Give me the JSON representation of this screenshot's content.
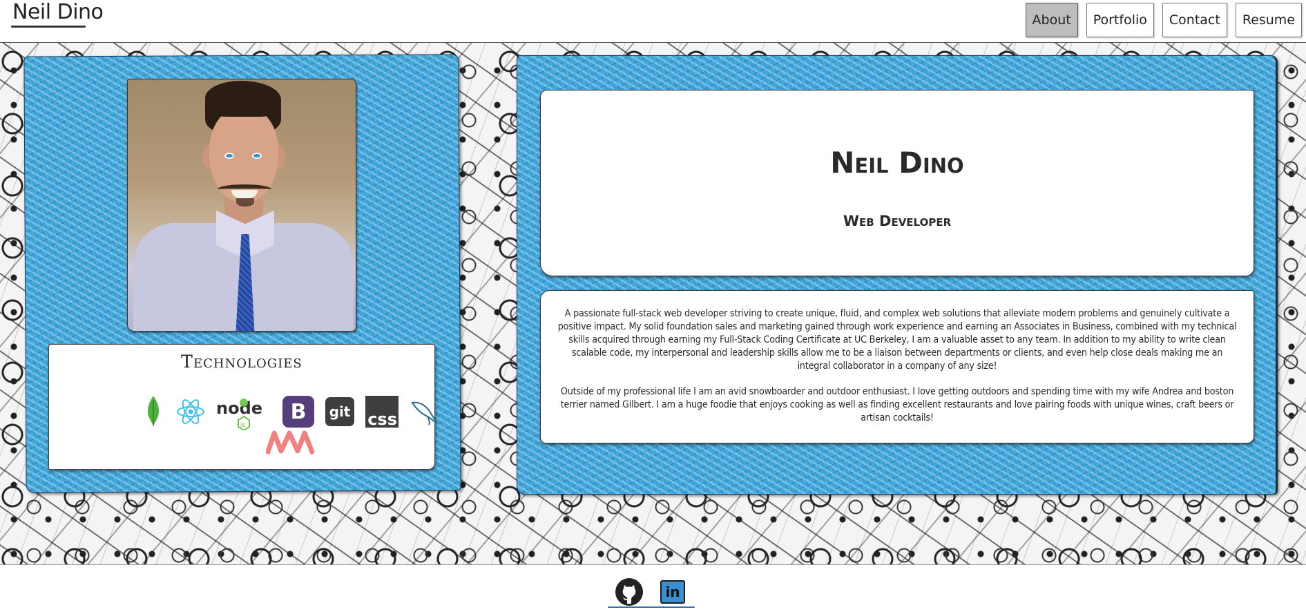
{
  "header": {
    "brand": "Neil Dino",
    "nav": [
      {
        "label": "About",
        "active": true
      },
      {
        "label": "Portfolio",
        "active": false
      },
      {
        "label": "Contact",
        "active": false
      },
      {
        "label": "Resume",
        "active": false
      }
    ]
  },
  "profile": {
    "technologies_title": "Technologies",
    "technologies": [
      {
        "icon": "mongodb-icon"
      },
      {
        "icon": "react-icon"
      },
      {
        "icon": "nodejs-icon",
        "label": "node"
      },
      {
        "icon": "bootstrap-icon",
        "label": "B"
      },
      {
        "icon": "git-icon",
        "label": "git"
      },
      {
        "icon": "css-icon",
        "label": "css"
      },
      {
        "icon": "mysql-icon"
      },
      {
        "icon": "mongoose-icon"
      }
    ]
  },
  "intro": {
    "name": "Neil Dino",
    "role": "Web Developer"
  },
  "bio": {
    "paragraph1": "A passionate full-stack web developer striving to create unique, fluid, and complex web solutions that alleviate modern problems and genuinely cultivate a positive impact. My solid foundation sales and marketing gained through work experience and earning an Associates in Business, combined with my technical skills acquired through earning my Full-Stack Coding Certificate at UC Berkeley, I am a valuable asset to any team. In addition to my ability to write clean scalable code, my interpersonal and leadership skills allow me to be a liaison between departments or clients, and even help close deals making me an integral collaborator in a company of any size!",
    "paragraph2": "Outside of my professional life I am an avid snowboarder and outdoor enthusiast. I love getting outdoors and spending time with my wife Andrea and boston terrier named Gilbert. I am a huge foodie that enjoys cooking as well as finding excellent restaurants and love pairing foods with unique wines, craft beers or artisan cocktails!"
  },
  "footer": {
    "links": [
      {
        "icon": "github-icon"
      },
      {
        "icon": "linkedin-icon",
        "label": "in"
      }
    ]
  },
  "colors": {
    "panel_blue": "#3aa3d8",
    "nav_active": "#bdbdbd",
    "bootstrap_purple": "#563d7c",
    "mongodb_green": "#4db33d",
    "react_blue": "#61dafb"
  }
}
